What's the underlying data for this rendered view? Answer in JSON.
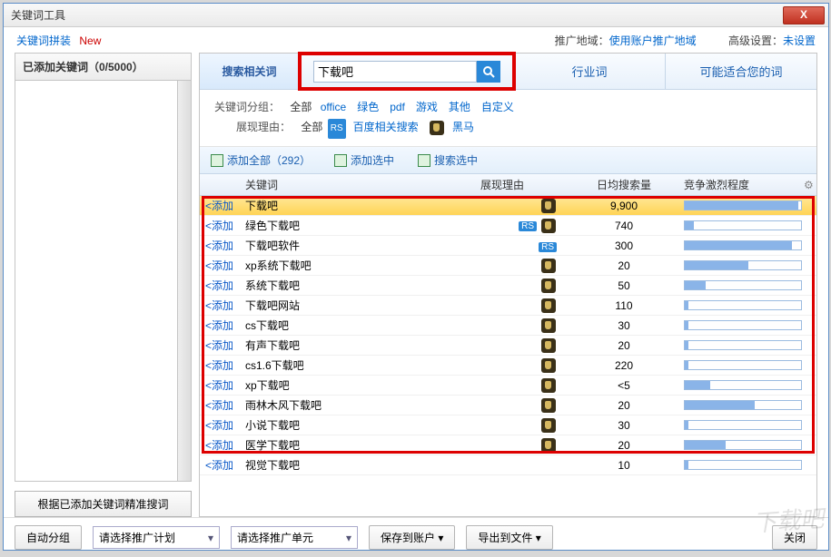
{
  "window": {
    "title": "关键词工具",
    "close": "X"
  },
  "toolbar": {
    "assemble": "关键词拼装",
    "new": "New",
    "region_label": "推广地域：",
    "region_value": "使用账户推广地域",
    "adv_label": "高级设置：",
    "adv_value": "未设置"
  },
  "left": {
    "header": "已添加关键词（0/5000）",
    "refine_btn": "根据已添加关键词精准搜词"
  },
  "tabs": {
    "related": "搜索相关词",
    "search_value": "下载吧",
    "industry": "行业词",
    "suggest": "可能适合您的词"
  },
  "filters": {
    "group_label": "关键词分组：",
    "all": "全部",
    "groups": [
      "office",
      "绿色",
      "pdf",
      "游戏",
      "其他",
      "自定义"
    ],
    "reason_label": "展现理由：",
    "rs_label": "百度相关搜索",
    "hm_label": "黑马"
  },
  "actions": {
    "add_all": "添加全部（292）",
    "add_sel": "添加选中",
    "search_sel": "搜索选中"
  },
  "columns": {
    "kw": "关键词",
    "reason": "展现理由",
    "daily": "日均搜索量",
    "comp": "竞争激烈程度"
  },
  "add_label": "添加",
  "rows": [
    {
      "kw": "下载吧",
      "rs": false,
      "hm": true,
      "daily": "9,900",
      "comp": 98,
      "sel": true
    },
    {
      "kw": "绿色下载吧",
      "rs": true,
      "hm": true,
      "daily": "740",
      "comp": 8
    },
    {
      "kw": "下载吧软件",
      "rs": true,
      "hm": false,
      "daily": "300",
      "comp": 92
    },
    {
      "kw": "xp系统下载吧",
      "rs": false,
      "hm": true,
      "daily": "20",
      "comp": 55
    },
    {
      "kw": "系统下载吧",
      "rs": false,
      "hm": true,
      "daily": "50",
      "comp": 18
    },
    {
      "kw": "下载吧网站",
      "rs": false,
      "hm": true,
      "daily": "110",
      "comp": 3
    },
    {
      "kw": "cs下载吧",
      "rs": false,
      "hm": true,
      "daily": "30",
      "comp": 3
    },
    {
      "kw": "有声下载吧",
      "rs": false,
      "hm": true,
      "daily": "20",
      "comp": 3
    },
    {
      "kw": "cs1.6下载吧",
      "rs": false,
      "hm": true,
      "daily": "220",
      "comp": 3
    },
    {
      "kw": "xp下载吧",
      "rs": false,
      "hm": true,
      "daily": "<5",
      "comp": 22
    },
    {
      "kw": "雨林木风下载吧",
      "rs": false,
      "hm": true,
      "daily": "20",
      "comp": 60
    },
    {
      "kw": "小说下载吧",
      "rs": false,
      "hm": true,
      "daily": "30",
      "comp": 3
    },
    {
      "kw": "医学下载吧",
      "rs": false,
      "hm": true,
      "daily": "20",
      "comp": 35
    },
    {
      "kw": "视觉下载吧",
      "rs": false,
      "hm": false,
      "daily": "10",
      "comp": 3
    }
  ],
  "bottom": {
    "autogroup": "自动分组",
    "plan_placeholder": "请选择推广计划",
    "unit_placeholder": "请选择推广单元",
    "save": "保存到账户",
    "export": "导出到文件",
    "close": "关闭"
  }
}
